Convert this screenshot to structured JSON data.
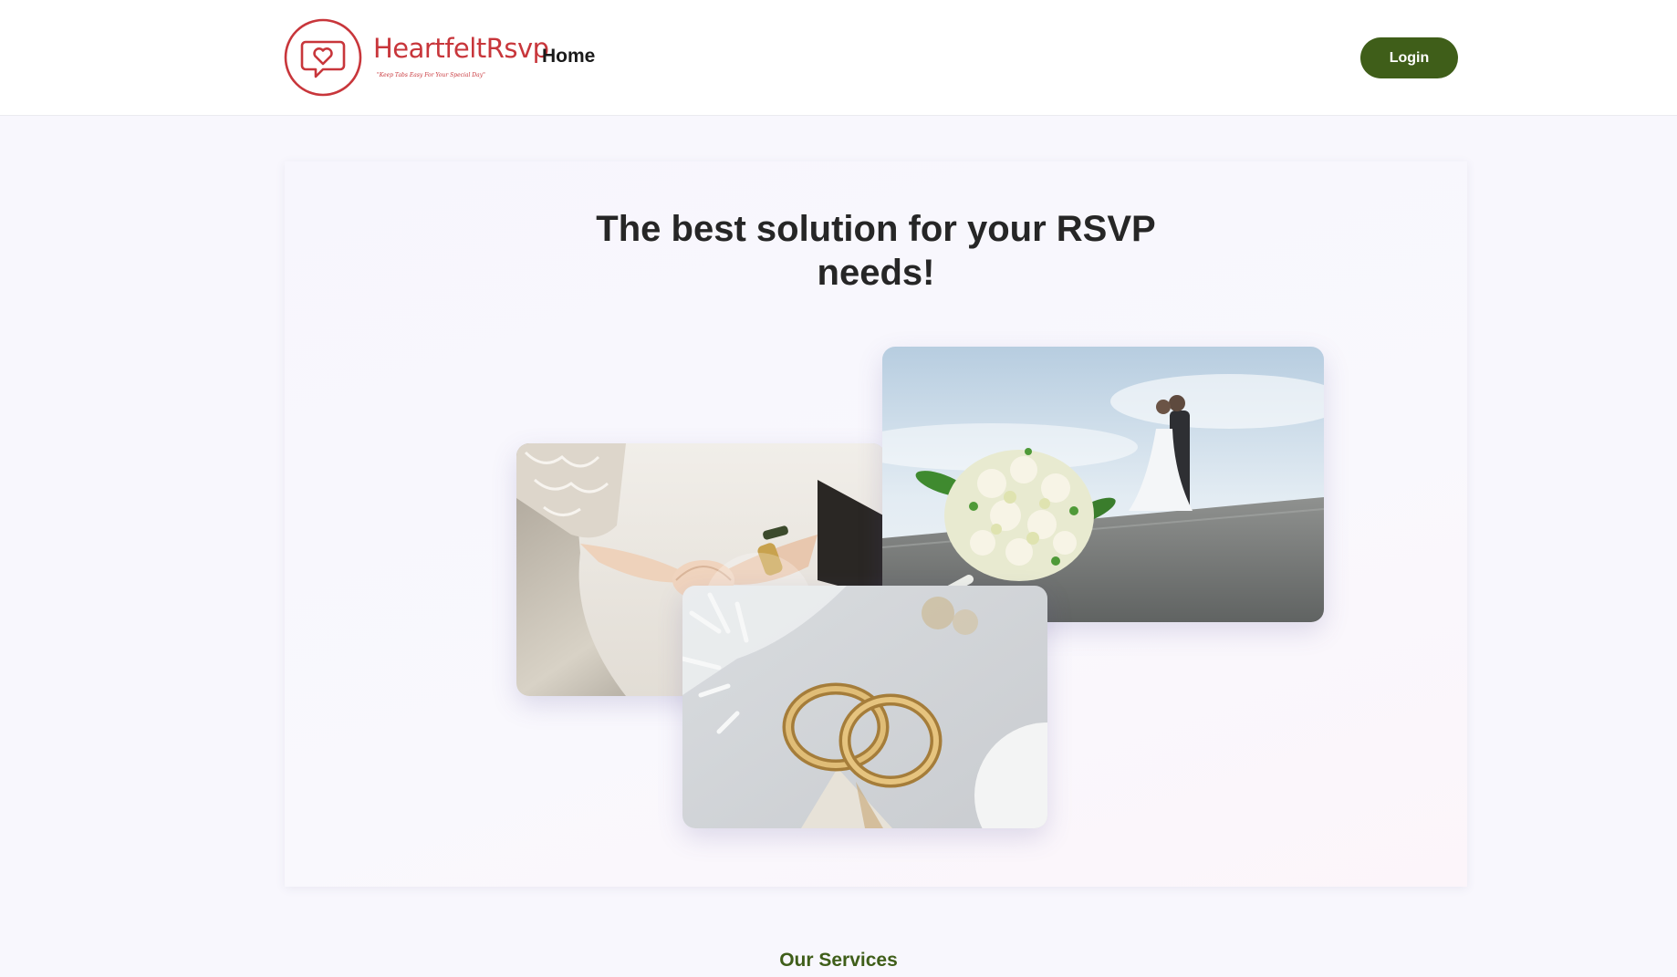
{
  "header": {
    "logo": {
      "name": "HeartfeltRsvp",
      "tagline": "\"Keep Tabs Easy For Your Special Day\"",
      "icon": "heart-chat-bubble-icon",
      "color": "#c8363b"
    },
    "nav": {
      "home_label": "Home"
    },
    "login_label": "Login"
  },
  "hero": {
    "title": "The best solution for your RSVP needs!",
    "photos": [
      {
        "name": "bride-groom-hands-photo"
      },
      {
        "name": "wedding-bouquet-couple-photo"
      },
      {
        "name": "wedding-rings-photo"
      }
    ]
  },
  "services": {
    "title": "Our Services"
  },
  "colors": {
    "accent": "#3f5e19",
    "brand": "#c8363b",
    "page_background": "#f8f7fd",
    "text": "#262626"
  }
}
